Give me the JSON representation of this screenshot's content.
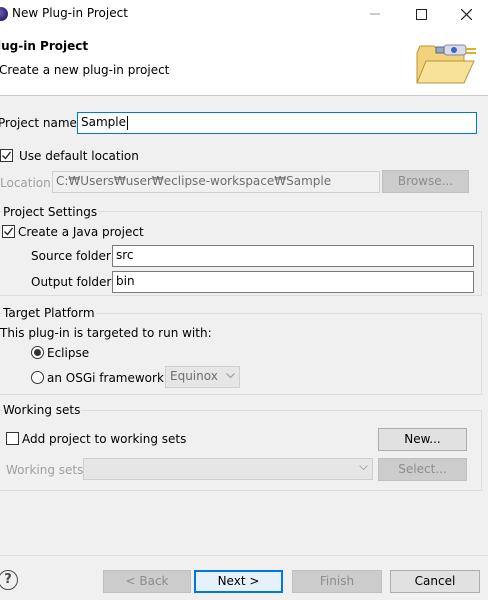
{
  "window": {
    "title": "New Plug-in Project",
    "icons": {
      "app": "eclipse-icon",
      "minimize": "minimize-icon",
      "maximize": "maximize-icon",
      "close": "close-icon"
    }
  },
  "header": {
    "title": "lug-in Project",
    "description": "Create a new plug-in project",
    "image_icon": "folder-plugin-icon"
  },
  "project": {
    "name_label": "Project name:",
    "name_value": "Sample",
    "use_default_label": "Use default location",
    "use_default_checked": true,
    "location_label": "Location:",
    "location_value": "C:₩Users₩user₩eclipse-workspace₩Sample",
    "browse_label": "Browse..."
  },
  "project_settings": {
    "title": "Project Settings",
    "create_java_label": "Create a Java project",
    "create_java_checked": true,
    "source_folder_label": "Source folder:",
    "source_folder_value": "src",
    "output_folder_label": "Output folder:",
    "output_folder_value": "bin"
  },
  "target_platform": {
    "title": "Target Platform",
    "description": "This plug-in is targeted to run with:",
    "eclipse_label": "Eclipse",
    "osgi_label": "an OSGi framework:",
    "selected": "Eclipse",
    "framework_value": "Equinox"
  },
  "working_sets": {
    "title": "Working sets",
    "add_label": "Add project to working sets",
    "add_checked": false,
    "new_label": "New...",
    "sets_label": "Working sets:",
    "sets_value": "",
    "select_label": "Select..."
  },
  "footer": {
    "help_glyph": "?",
    "back_label": "< Back",
    "next_label": "Next >",
    "finish_label": "Finish",
    "cancel_label": "Cancel"
  },
  "colors": {
    "focus": "#0078d7",
    "disabled_text": "#a0a0a0",
    "background": "#f0f0f0"
  }
}
